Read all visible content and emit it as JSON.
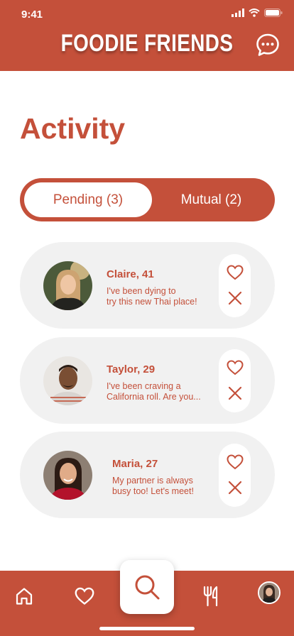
{
  "status_bar": {
    "time": "9:41"
  },
  "header": {
    "title": "FOODIE FRIENDS"
  },
  "page_title": "Activity",
  "tabs": [
    {
      "label": "Pending (3)",
      "selected": true
    },
    {
      "label": "Mutual (2)",
      "selected": false
    }
  ],
  "requests": [
    {
      "name": "Claire, 41",
      "message_lines": [
        "I've been dying to",
        "try this new Thai place!"
      ]
    },
    {
      "name": "Taylor, 29",
      "message_lines": [
        "I've been craving a",
        "California roll. Are you..."
      ]
    },
    {
      "name": "Maria, 27",
      "message_lines": [
        "My partner is always",
        "busy too! Let's meet!"
      ]
    }
  ],
  "bottom_nav": [
    "home-icon",
    "heart-icon",
    "search-icon",
    "fork-knife-icon",
    "profile-avatar"
  ],
  "colors": {
    "accent": "#c4503a",
    "card_bg": "#f1f1f1",
    "white": "#ffffff"
  }
}
